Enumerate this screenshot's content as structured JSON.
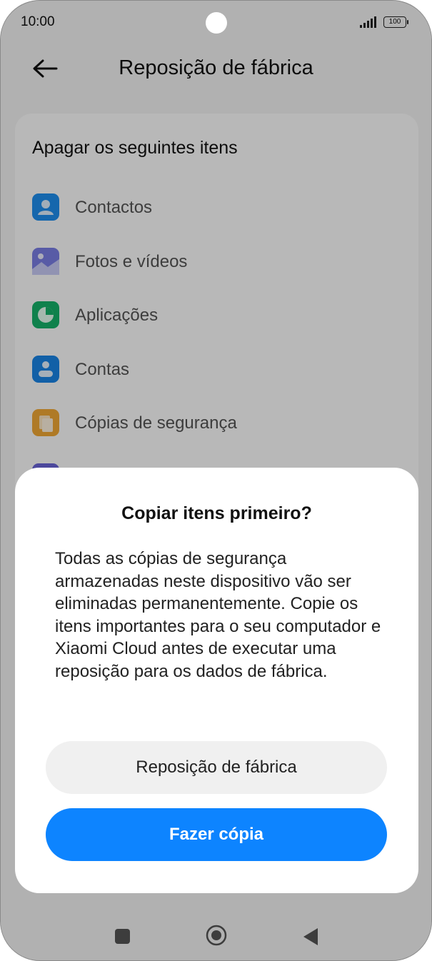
{
  "status_bar": {
    "time": "10:00",
    "battery": "100",
    "icons": [
      "signal-icon",
      "battery-icon"
    ]
  },
  "header": {
    "title": "Reposição de fábrica",
    "back_icon": "arrow-left-icon"
  },
  "card": {
    "title": "Apagar os seguintes itens",
    "items": [
      {
        "label": "Contactos",
        "icon": "contacts-icon",
        "color": "#1e8ff0"
      },
      {
        "label": "Fotos e vídeos",
        "icon": "gallery-icon",
        "color": "#7b7fe6"
      },
      {
        "label": "Aplicações",
        "icon": "apps-pie-icon",
        "color": "#16b36a"
      },
      {
        "label": "Contas",
        "icon": "account-icon",
        "color": "#1a86e8"
      },
      {
        "label": "Cópias de segurança",
        "icon": "backup-icon",
        "color": "#f3a935"
      }
    ]
  },
  "dialog": {
    "title": "Copiar itens primeiro?",
    "message": "Todas as cópias de segurança armazenadas neste dispositivo vão ser eliminadas permanentemente. Copie os itens importantes para o seu computador e Xiaomi Cloud antes de executar uma reposição para os dados de fábrica.",
    "secondary_button": "Reposição de fábrica",
    "primary_button": "Fazer cópia"
  },
  "colors": {
    "accent": "#0d84ff",
    "secondary_button_bg": "#f0f0f0"
  }
}
